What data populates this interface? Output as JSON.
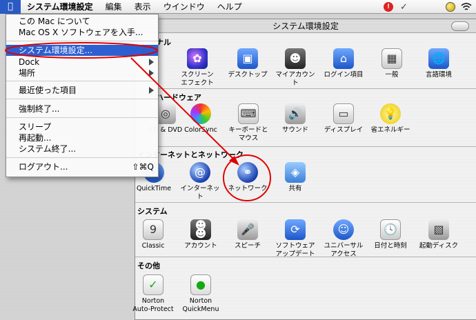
{
  "menubar": {
    "apple_icon": "apple-logo-icon",
    "app_menu": "システム環境設定",
    "menus": [
      "編集",
      "表示",
      "ウインドウ",
      "ヘルプ"
    ]
  },
  "window": {
    "title": "システム環境設定",
    "sections": [
      {
        "title": "パーソナル",
        "visible_title": "ナル"
      },
      {
        "title": "ハードウェア",
        "visible_title": "ハードウェア"
      },
      {
        "title": "インターネットとネットワーク",
        "visible_title": "インターネットとネットワーク"
      },
      {
        "title": "システム",
        "visible_title": "システム"
      },
      {
        "title": "その他",
        "visible_title": "その他"
      }
    ],
    "personal": [
      {
        "label": "スクリーン\nエフェクト",
        "icon": "screen-effects-icon"
      },
      {
        "label": "デスクトップ",
        "icon": "desktop-icon"
      },
      {
        "label": "マイアカウント",
        "icon": "my-account-icon"
      },
      {
        "label": "ログイン項目",
        "icon": "login-items-icon"
      },
      {
        "label": "一般",
        "icon": "general-icon"
      },
      {
        "label": "言語環境",
        "icon": "international-icon"
      }
    ],
    "hardware": [
      {
        "label": "CD & DVD",
        "icon": "cd-dvd-icon"
      },
      {
        "label": "ColorSync",
        "icon": "colorsync-icon"
      },
      {
        "label": "キーボードと\nマウス",
        "icon": "keyboard-mouse-icon"
      },
      {
        "label": "サウンド",
        "icon": "sound-icon"
      },
      {
        "label": "ディスプレイ",
        "icon": "displays-icon"
      },
      {
        "label": "省エネルギー",
        "icon": "energy-saver-icon"
      }
    ],
    "internet": [
      {
        "label": "QuickTime",
        "icon": "quicktime-icon"
      },
      {
        "label": "インターネット",
        "icon": "internet-icon"
      },
      {
        "label": "ネットワーク",
        "icon": "network-icon"
      },
      {
        "label": "共有",
        "icon": "sharing-icon"
      }
    ],
    "system": [
      {
        "label": "Classic",
        "icon": "classic-icon"
      },
      {
        "label": "アカウント",
        "icon": "accounts-icon"
      },
      {
        "label": "スピーチ",
        "icon": "speech-icon"
      },
      {
        "label": "ソフトウェア\nアップデート",
        "icon": "software-update-icon"
      },
      {
        "label": "ユニバーサル\nアクセス",
        "icon": "universal-access-icon"
      },
      {
        "label": "日付と時刻",
        "icon": "date-time-icon"
      },
      {
        "label": "起動ディスク",
        "icon": "startup-disk-icon"
      }
    ],
    "other": [
      {
        "label": "Norton\nAuto-Protect",
        "icon": "norton-autoprotect-icon"
      },
      {
        "label": "Norton\nQuickMenu",
        "icon": "norton-quickmenu-icon"
      }
    ]
  },
  "apple_menu": {
    "items": [
      {
        "label": "この Mac について"
      },
      {
        "label": "Mac OS X ソフトウェアを入手..."
      },
      {
        "label": "システム環境設定..."
      },
      {
        "label": "Dock"
      },
      {
        "label": "場所"
      },
      {
        "label": "最近使った項目"
      },
      {
        "label": "強制終了..."
      },
      {
        "label": "スリープ"
      },
      {
        "label": "再起動..."
      },
      {
        "label": "システム終了..."
      },
      {
        "label": "ログアウト...",
        "shortcut": "⇧⌘Q"
      }
    ]
  },
  "annotation": {
    "color": "#e00000"
  }
}
